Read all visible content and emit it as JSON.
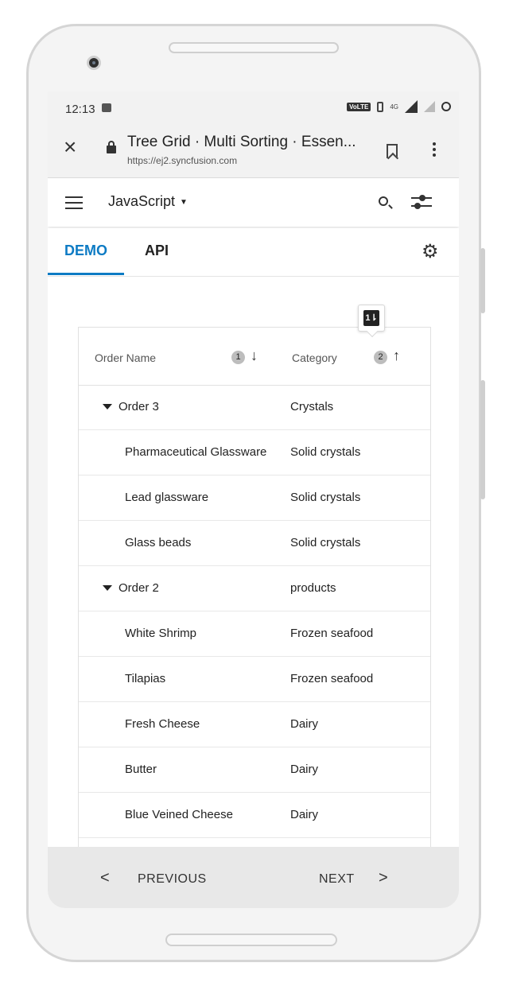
{
  "status_bar": {
    "time": "12:13",
    "volte_label": "VoLTE",
    "network_label": "4G"
  },
  "browser": {
    "page_title": "Tree Grid · Multi Sorting · Essen...",
    "url": "https://ej2.syncfusion.com"
  },
  "app_bar": {
    "platform_label": "JavaScript"
  },
  "tabs": [
    {
      "label": "DEMO",
      "active": true
    },
    {
      "label": "API",
      "active": false
    }
  ],
  "grid": {
    "columns": [
      {
        "label": "Order Name",
        "sort_order": "1",
        "sort_direction": "↓"
      },
      {
        "label": "Category",
        "sort_order": "2",
        "sort_direction": "↑"
      }
    ],
    "sort_toggle_glyph": "1⇂",
    "rows": [
      {
        "name": "Order 3",
        "category": "Crystals",
        "parent": true
      },
      {
        "name": "Pharmaceutical Glassware",
        "category": "Solid crystals",
        "parent": false
      },
      {
        "name": "Lead glassware",
        "category": "Solid crystals",
        "parent": false
      },
      {
        "name": "Glass beads",
        "category": "Solid crystals",
        "parent": false
      },
      {
        "name": "Order 2",
        "category": "products",
        "parent": true
      },
      {
        "name": "White Shrimp",
        "category": "Frozen seafood",
        "parent": false
      },
      {
        "name": "Tilapias",
        "category": "Frozen seafood",
        "parent": false
      },
      {
        "name": "Fresh Cheese",
        "category": "Dairy",
        "parent": false
      },
      {
        "name": "Butter",
        "category": "Dairy",
        "parent": false
      },
      {
        "name": "Blue Veined Cheese",
        "category": "Dairy",
        "parent": false
      }
    ]
  },
  "footer": {
    "previous_label": "PREVIOUS",
    "next_label": "NEXT",
    "previous_chevron": "<",
    "next_chevron": ">"
  },
  "colors": {
    "accent": "#0d7bc4",
    "footer_bg": "#e8e8e8",
    "sort_badge": "#bdbdbd"
  }
}
